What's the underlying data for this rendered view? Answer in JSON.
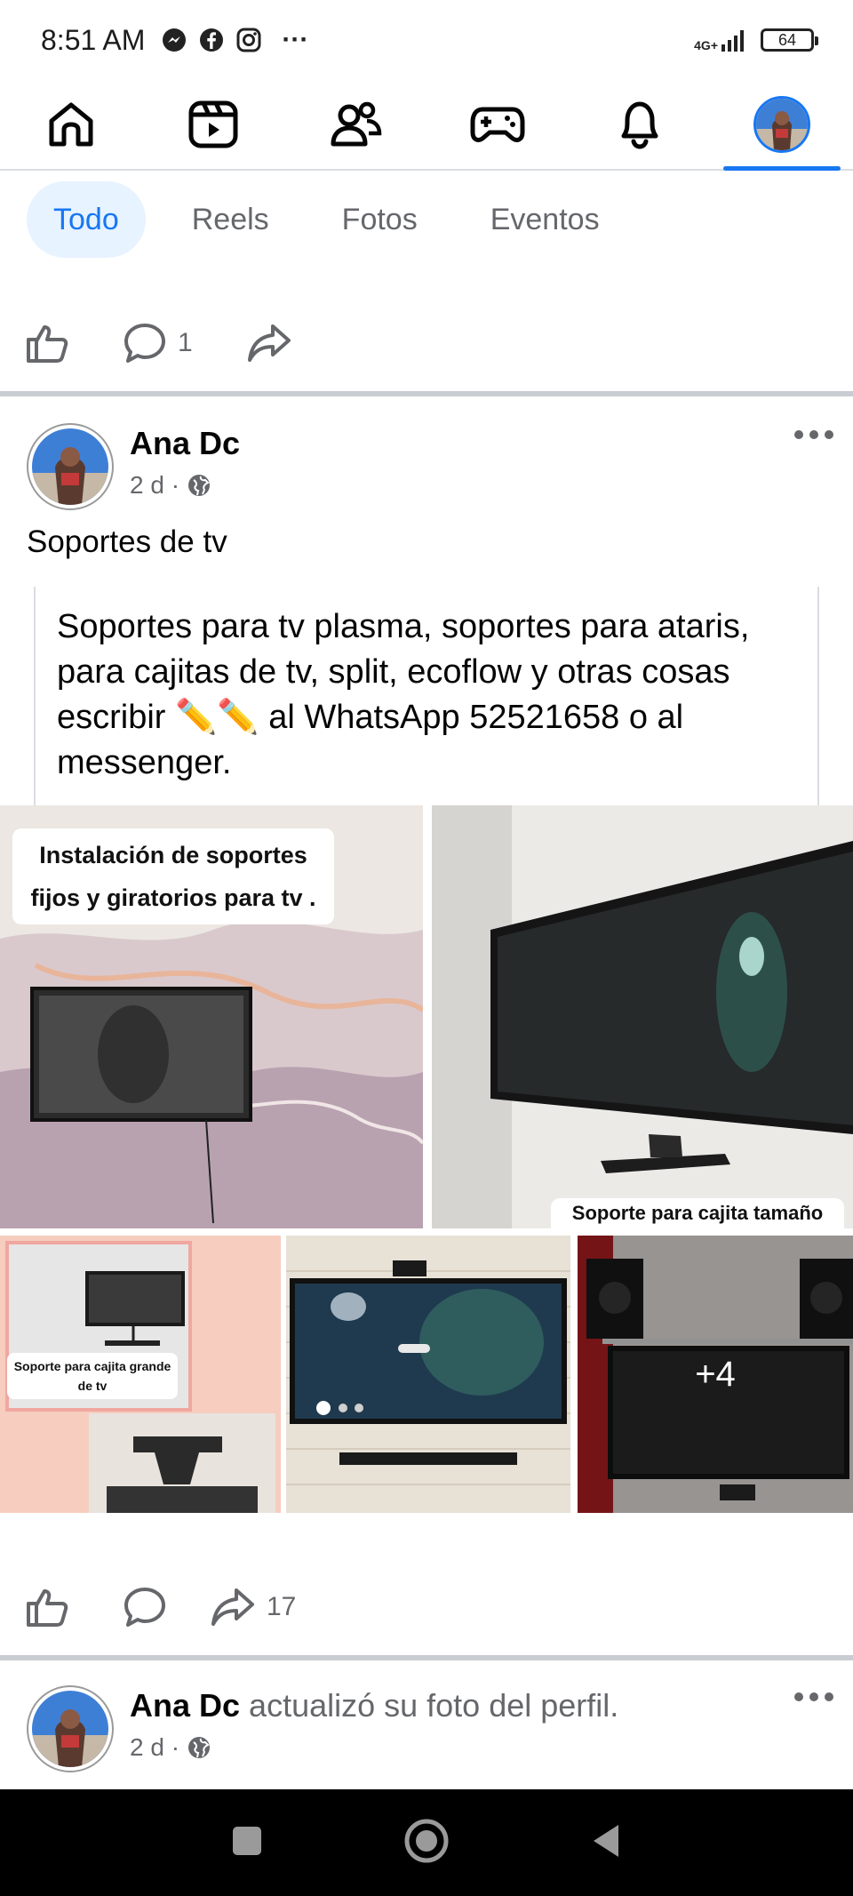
{
  "status_bar": {
    "time": "8:51 AM",
    "network": "4G+",
    "battery": "64",
    "more": "···"
  },
  "top_nav": {
    "items": [
      {
        "name": "home-icon"
      },
      {
        "name": "reels-icon"
      },
      {
        "name": "friends-icon"
      },
      {
        "name": "gaming-icon"
      },
      {
        "name": "notifications-bell-icon"
      },
      {
        "name": "profile-avatar",
        "active": true
      }
    ]
  },
  "filters": {
    "chips": [
      "Todo",
      "Reels",
      "Fotos",
      "Eventos"
    ],
    "selected": "Todo"
  },
  "previous_post_actions": {
    "comment_count": "1"
  },
  "post": {
    "author": "Ana Dc",
    "time": "2 d ·",
    "caption": "Soportes de tv",
    "shared_text": "Soportes para tv plasma, soportes para ataris, para cajitas de tv, split, ecoflow y otras cosas escribir ✏️✏️ al WhatsApp 52521658 o al messenger.",
    "photos": {
      "label_1": "Instalación de soportes fijos y giratorios para tv .",
      "label_2": "Soporte para cajita tamaño",
      "label_3": "Soporte para cajita grande de tv",
      "more_count": "+4"
    },
    "share_count": "17"
  },
  "next_post": {
    "author": "Ana Dc",
    "activity": "actualizó su foto del perfil.",
    "time": "2 d ·"
  },
  "colors": {
    "accent": "#1877f2",
    "chip_bg": "#e7f3ff",
    "muted_text": "#65676b",
    "separator": "#c9ccd1"
  }
}
